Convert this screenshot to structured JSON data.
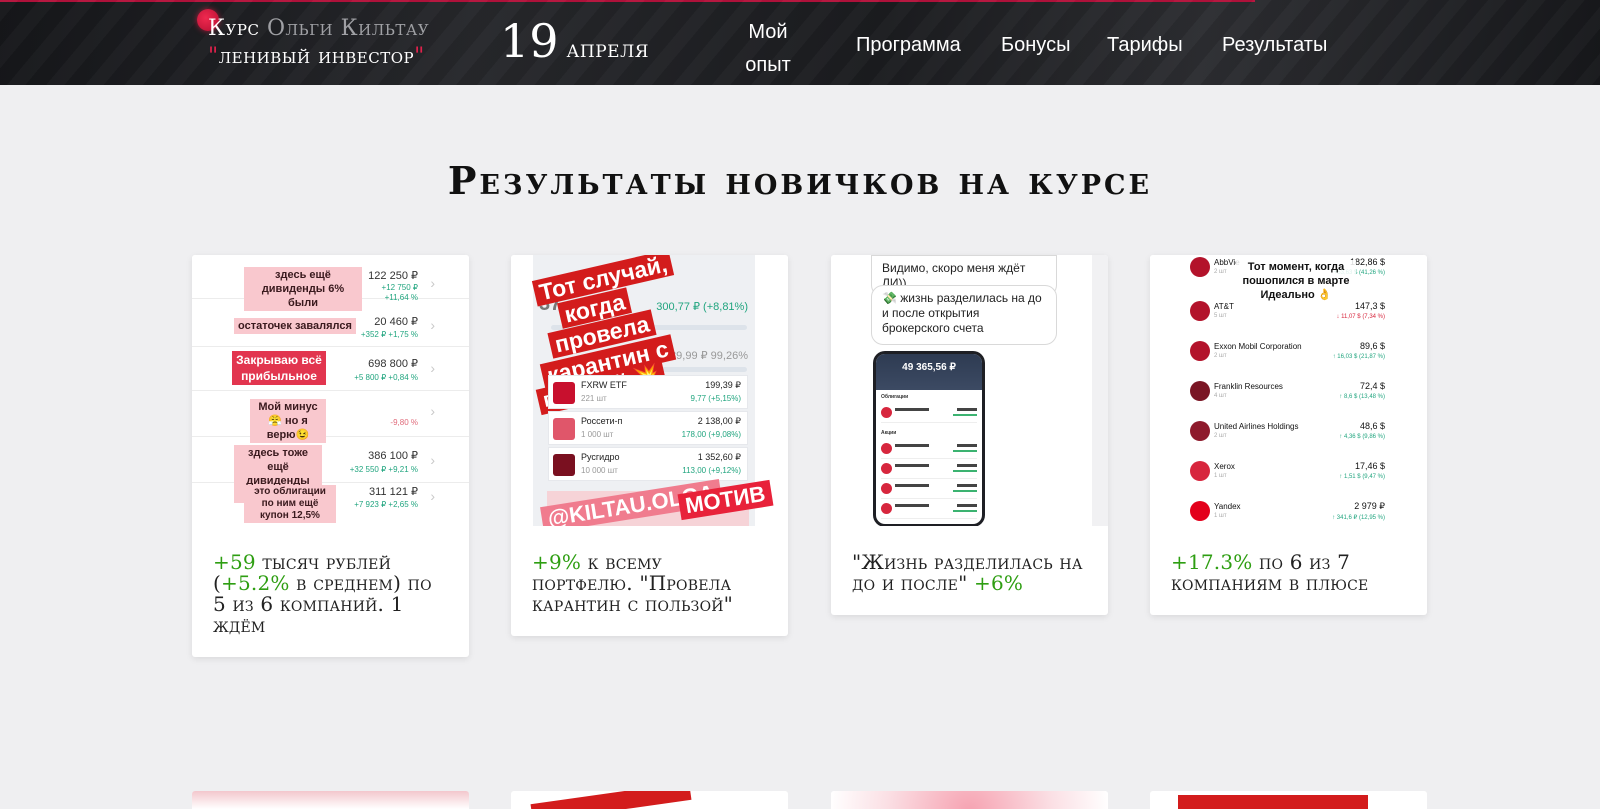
{
  "header": {
    "brand_line1_a": "Курс",
    "brand_line1_b": "Ольги Кильтау",
    "brand_line2_q1": "\"",
    "brand_line2": "ленивый инвестор",
    "brand_line2_q2": "\"",
    "date_day": "19",
    "date_month": "апреля",
    "nav": {
      "my_experience_1": "Мой",
      "my_experience_2": "опыт",
      "program": "Программа",
      "bonuses": "Бонусы",
      "tariffs": "Тарифы",
      "results": "Результаты"
    }
  },
  "section_title": "Результаты новичков на курсе",
  "cards": [
    {
      "caption_hl1": "+59",
      "caption_t1": " тысяч рублей (",
      "caption_hl2": "+5.2%",
      "caption_t2": " в среднем) по 5 из 6 компаний. 1 ждём",
      "rows": [
        {
          "sticker": "здесь ещё дивиденды 6% были",
          "amount": "122 250 ₽",
          "g1": "+12 750 ₽",
          "g2": "+11,64 %"
        },
        {
          "sticker": "остаточек завалялся",
          "amount": "20 460 ₽",
          "g1": "+352 ₽   +1,75 %"
        },
        {
          "sticker": "Закрываю всё прибыльное",
          "amount": "698 800 ₽",
          "g1": "+5 800 ₽   +0,84 %"
        },
        {
          "sticker": "Мой минус😤 но я верю😉",
          "amount": "-9,80 %"
        },
        {
          "sticker": "здесь тоже ещё дивиденды +4%",
          "amount": "386 100 ₽",
          "g1": "+32 550 ₽   +9,21 %"
        },
        {
          "sticker": "это облигации по ним ещё купон 12,5%",
          "amount": "311 121 ₽",
          "g1": "+7 923 ₽   +2,65 %"
        }
      ]
    },
    {
      "caption_hl1": "+9%",
      "caption_t1": " к всему портфелю. \"Провела карантин с пользой\"",
      "banner_lines": [
        "Тот случай,",
        "когда",
        "провела",
        "карантин с",
        "пользой 💥"
      ],
      "total1": "300,77 ₽ (+8,81%)",
      "total2": "689,99 ₽  99,26%",
      "bottom_tag": "@KILTAU.OLGA",
      "bottom_tag2": "МОТИВ",
      "rows": [
        {
          "name": "FXRW ETF",
          "sub": "221 шт",
          "price": "199,39 ₽",
          "chg": "9,77 (+5,15%)"
        },
        {
          "name": "Россети-п",
          "sub": "1 000 шт",
          "price": "2 138,00 ₽",
          "chg": "178,00 (+9,08%)"
        },
        {
          "name": "Русгидро",
          "sub": "10 000 шт",
          "price": "1 352,60 ₽",
          "chg": "113,00 (+9,12%)"
        }
      ]
    },
    {
      "caption_t1": "\"Жизнь разделилась на до и после\" ",
      "caption_hl1": "+6%",
      "bubble1": "Видимо, скоро меня ждёт ЛИ))",
      "bubble2": "💸 жизнь разделилась на до и после открытия брокерского счета",
      "phone_total": "49 365,56 ₽",
      "phone_sec1": "Облигации",
      "phone_sec2": "Акции"
    },
    {
      "caption_hl1": "+17.3%",
      "caption_t1": " по 6 из 7 компаниям в плюсе",
      "note": "Тот момент, когда пошопился в марте Идеально 👌",
      "stocks": [
        {
          "name": "AbbVie",
          "sub": "2 шт",
          "price": "182,86 $",
          "chg": "+53,63 $ (41,26 %)"
        },
        {
          "name": "AT&T",
          "sub": "5 шт",
          "price": "147,3 $",
          "chg": "↓ 11,07 $ (7,34 %)"
        },
        {
          "name": "Exxon Mobil Corporation",
          "sub": "2 шт",
          "price": "89,6 $",
          "chg": "↑ 16,03 $ (21,87 %)"
        },
        {
          "name": "Franklin Resources",
          "sub": "4 шт",
          "price": "72,4 $",
          "chg": "↑ 8,6 $ (13,48 %)"
        },
        {
          "name": "United Airlines Holdings",
          "sub": "2 шт",
          "price": "48,6 $",
          "chg": "↑ 4,36 $ (9,86 %)"
        },
        {
          "name": "Xerox",
          "sub": "1 шт",
          "price": "17,46 $",
          "chg": "↑ 1,51 $ (9,47 %)"
        },
        {
          "name": "Yandex",
          "sub": "1 шт",
          "price": "2 979 ₽",
          "chg": "↑ 341,6 ₽ (12,95 %)"
        }
      ]
    }
  ],
  "colors": {
    "accent": "#e0224c",
    "gain": "#2e9e12",
    "header_bg": "#1c1d20",
    "page_bg": "#efeff1"
  }
}
